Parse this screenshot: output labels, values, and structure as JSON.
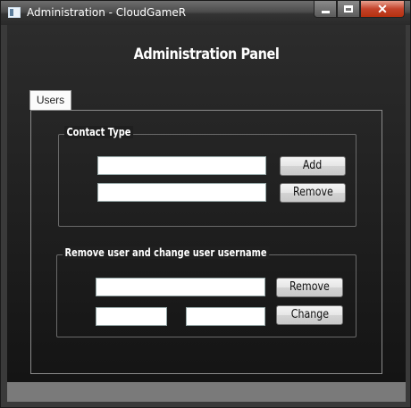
{
  "window": {
    "title": "Administration - CloudGameR"
  },
  "panel": {
    "title": "Administration Panel"
  },
  "tabs": [
    {
      "label": "Users"
    }
  ],
  "contact_type": {
    "legend": "Contact Type",
    "input_1_value": "",
    "input_2_value": "",
    "add_label": "Add",
    "remove_label": "Remove"
  },
  "remove_user": {
    "legend": "Remove user and change user username",
    "username_value": "",
    "old_name_value": "",
    "new_name_value": "",
    "remove_label": "Remove",
    "change_label": "Change"
  },
  "icons": {
    "app": "app-window-icon",
    "minimize": "minimize-icon",
    "maximize": "maximize-icon",
    "close": "close-icon"
  }
}
